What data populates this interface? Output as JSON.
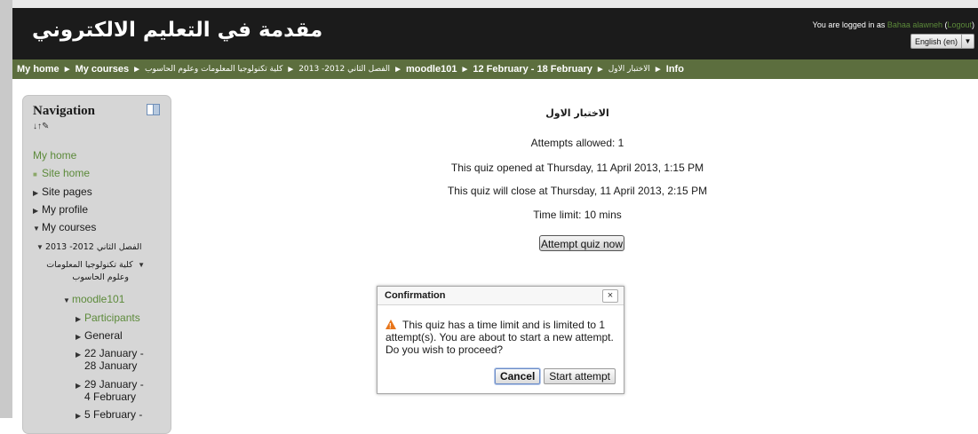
{
  "header": {
    "site_title": "مقدمة في التعليم الالكتروني",
    "login_prefix": "You are logged in as ",
    "user_name": "Bahaa alawneh",
    "logout_label": "Logout",
    "language": "English (en)"
  },
  "breadcrumb": [
    "My home",
    "My courses",
    "كلية تكنولوجيا المعلومات وعلوم الحاسوب",
    "الفصل الثاني 2012- 2013",
    "moodle101",
    "12 February - 18 February",
    "الاختبار الاول",
    "Info"
  ],
  "navigation": {
    "title": "Navigation",
    "move_icon": "↓↑✎",
    "my_home": "My home",
    "site_home": "Site home",
    "site_pages": "Site pages",
    "my_profile": "My profile",
    "my_courses": "My courses",
    "semester": "الفصل الثاني 2012- 2013",
    "faculty_line1": "كلية تكنولوجيا المعلومات",
    "faculty_line2": "وعلوم الحاسوب",
    "course": "moodle101",
    "participants": "Participants",
    "general": "General",
    "week1_a": "22 January -",
    "week1_b": "28 January",
    "week2_a": "29 January -",
    "week2_b": "4 February",
    "week3_a": "5 February -"
  },
  "quiz": {
    "title": "الاختبار الاول",
    "attempts_allowed": "Attempts allowed: 1",
    "opened": "This quiz opened at Thursday, 11 April 2013, 1:15 PM",
    "closes": "This quiz will close at Thursday, 11 April 2013, 2:15 PM",
    "time_limit": "Time limit: 10 mins",
    "attempt_button": "Attempt quiz now"
  },
  "dialog": {
    "title": "Confirmation",
    "close": "×",
    "message": "This quiz has a time limit and is limited to 1 attempt(s). You are about to start a new attempt. Do you wish to proceed?",
    "cancel_label": "Cancel",
    "start_label": "Start attempt"
  },
  "colors": {
    "header_bg": "#1b1b1b",
    "navbar_bg": "#5c6e3e",
    "link_green": "#5c8a3a",
    "sidebar_bg": "#d6d6d6",
    "warning": "#e8751a"
  }
}
